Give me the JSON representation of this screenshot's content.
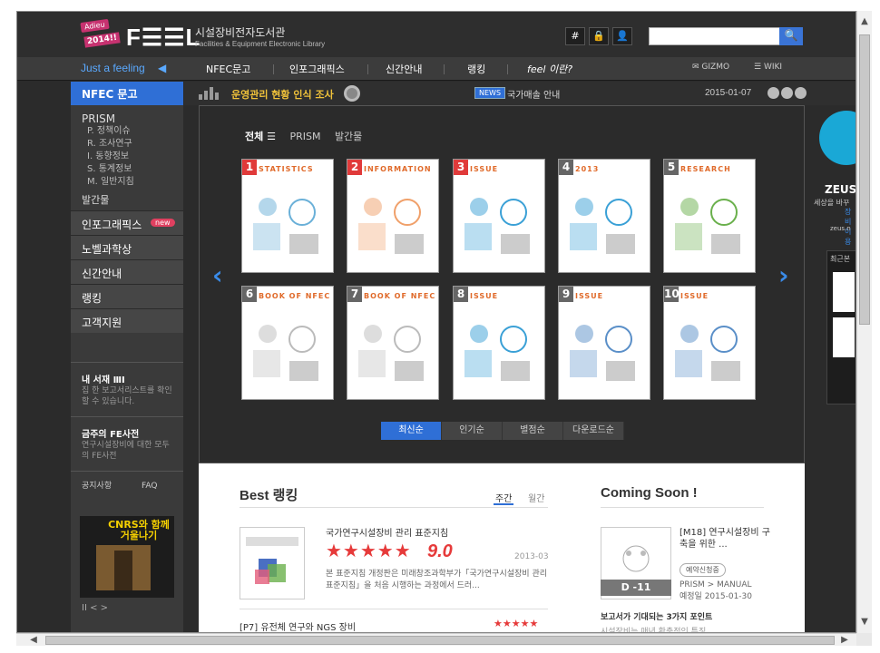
{
  "header": {
    "badge_adieu": "Adieu",
    "badge_year": "2014!!",
    "logo_word": "F☰☰L",
    "logo_kr": "시설장비전자도서관",
    "logo_en": "Facilities & Equipment Electronic Library",
    "btn_hash": "#",
    "btn_lock": "🔒",
    "btn_user": "👤",
    "search_icon": "🔍"
  },
  "nav": {
    "tagline": "Just a feeling",
    "items": [
      "NFEC문고",
      "인포그래픽스",
      "신간안내",
      "랭킹",
      "feel 이란?"
    ],
    "gizmo": "GIZMO",
    "wiki": "WIKI"
  },
  "sidebar": {
    "active": "NFEC 문고",
    "prism": "PRISM",
    "prism_items": [
      "P. 정책이슈",
      "R. 조사연구",
      "I. 동향정보",
      "S. 통계정보",
      "M. 일반지침"
    ],
    "publication": "발간물",
    "rows": [
      "인포그래픽스",
      "노벨과학상",
      "신간안내",
      "랭킹",
      "고객지원"
    ],
    "new_badge": "new",
    "shelf_title": "내 서재 ⅢⅠ",
    "shelf_desc": "집 한 보고서리스트를 확인할 수 있습니다.",
    "fe_title": "금주의 FE사전",
    "fe_desc": "연구시설장비에 대한 모두의 FE사전",
    "notice": "공지사항",
    "faq": "FAQ",
    "cnrs_text": "CNRS와 함께 거울나기",
    "pager": "II < >"
  },
  "newsbar": {
    "survey": "운영관리 현황 인식 조사",
    "news_badge": "NEWS",
    "news_text": "국가매솔 안내",
    "date": "2015-01-07"
  },
  "books": {
    "tabs": [
      "전체 ☰",
      "PRISM",
      "발간물"
    ],
    "cards": [
      {
        "num": "1",
        "head": "STATISTICS",
        "color": "#e03a3a"
      },
      {
        "num": "2",
        "head": "INFORMATION",
        "color": "#e03a3a"
      },
      {
        "num": "3",
        "head": "ISSUE",
        "color": "#e03a3a"
      },
      {
        "num": "4",
        "head": "2013",
        "color": "#666666"
      },
      {
        "num": "5",
        "head": "RESEARCH",
        "color": "#666666"
      },
      {
        "num": "6",
        "head": "BOOK OF NFEC",
        "color": "#666666"
      },
      {
        "num": "7",
        "head": "BOOK OF NFEC",
        "color": "#666666"
      },
      {
        "num": "8",
        "head": "ISSUE",
        "color": "#666666"
      },
      {
        "num": "9",
        "head": "ISSUE",
        "color": "#666666"
      },
      {
        "num": "10",
        "head": "ISSUE",
        "color": "#666666"
      }
    ],
    "sorts": [
      "최신순",
      "인기순",
      "별점순",
      "다운로드순"
    ]
  },
  "best": {
    "title": "Best 랭킹",
    "weekly": "주간",
    "monthly": "월간",
    "item_title": "국가연구시설장비 관리 표준지침",
    "stars": "★★★★★",
    "score": "9.0",
    "code": "2013-03",
    "desc": "본 표준지침 개정판은 미래창조과학부가「국가연구시설장비 관리 표준지침」을 처음 시행하는 과정에서 드러...",
    "item2": "[P7] 유전체 연구와 NGS 장비",
    "stars2": "★★★★★"
  },
  "coming": {
    "title": "Coming Soon !",
    "d_day": "D -11",
    "book_title": "[M18] 연구시설장비 구축을 위한 ...",
    "reserve": "예약신청중",
    "path": "PRISM > MANUAL",
    "planned": "예정일 2015-01-30",
    "points": "보고서가 기대되는 3가지 포인트",
    "point1": "시설장비는 매년 확충적인 특징"
  },
  "right": {
    "zeus": "ZEUS",
    "zeus_line": "세상을 바꾸",
    "zeus_line2": "장비이용",
    "zeus_url": "zeus.n",
    "recent": "최근본"
  }
}
